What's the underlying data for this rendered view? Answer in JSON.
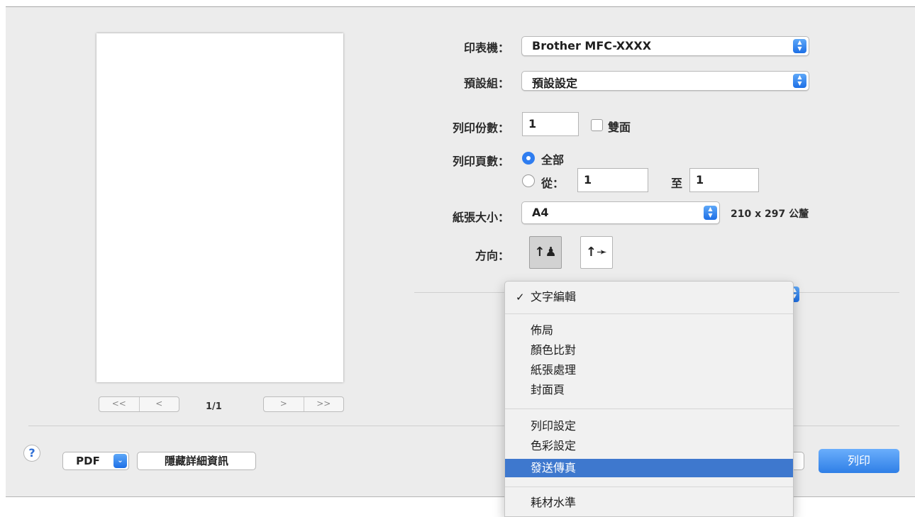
{
  "preview": {
    "page_indicator": "1/1",
    "nav": {
      "first": "<<",
      "prev": "<",
      "next": ">",
      "last": ">>"
    }
  },
  "form": {
    "printer": {
      "label": "印表機：",
      "value": "Brother MFC-XXXX"
    },
    "presets": {
      "label": "預設組：",
      "value": "預設設定"
    },
    "copies": {
      "label": "列印份數：",
      "value": "1",
      "duplex_label": "雙面"
    },
    "pages": {
      "label": "列印頁數：",
      "all_label": "全部",
      "from_label": "從：",
      "from_value": "1",
      "to_label": "至",
      "to_value": "1"
    },
    "paper_size": {
      "label": "紙張大小：",
      "value": "A4",
      "dimensions": "210 x 297 公釐"
    },
    "orientation": {
      "label": "方向：",
      "portrait_icon": "↑♟",
      "landscape_icon": "↑➛"
    }
  },
  "menu": {
    "checked": "文字編輯",
    "group1": [
      "佈局",
      "顏色比對",
      "紙張處理",
      "封面頁"
    ],
    "group2": [
      "列印設定",
      "色彩設定",
      "發送傳真"
    ],
    "highlighted": "發送傳真",
    "group3": [
      "耗材水準"
    ]
  },
  "bottom": {
    "help": "?",
    "pdf_label": "PDF",
    "hide_details": "隱藏詳細資訊",
    "print": "列印"
  },
  "colors": {
    "accent": "#2f7df0",
    "menu_highlight": "#3e78ce",
    "dialog_bg": "#ececec"
  }
}
